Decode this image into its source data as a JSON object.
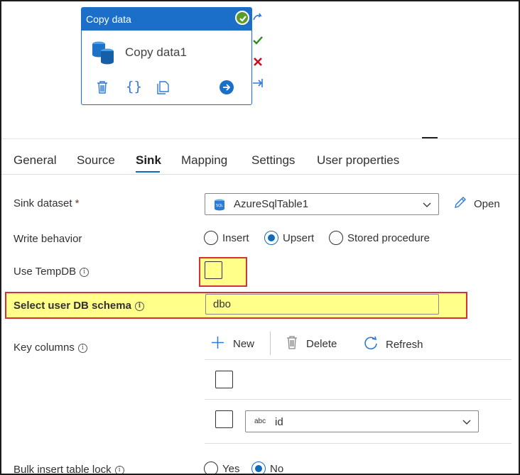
{
  "activity": {
    "type_label": "Copy data",
    "name": "Copy data1"
  },
  "tabs": [
    {
      "label": "General"
    },
    {
      "label": "Source"
    },
    {
      "label": "Sink"
    },
    {
      "label": "Mapping"
    },
    {
      "label": "Settings"
    },
    {
      "label": "User properties"
    }
  ],
  "active_tab": "Sink",
  "form": {
    "sink_dataset": {
      "label": "Sink dataset",
      "required_mark": "*",
      "value": "AzureSqlTable1",
      "open_label": "Open"
    },
    "write_behavior": {
      "label": "Write behavior",
      "options": [
        "Insert",
        "Upsert",
        "Stored procedure"
      ],
      "selected": "Upsert"
    },
    "use_tempdb": {
      "label": "Use TempDB",
      "checked": false
    },
    "user_db_schema": {
      "label": "Select user DB schema",
      "value": "dbo"
    },
    "key_columns": {
      "label": "Key columns",
      "toolbar": {
        "new_label": "New",
        "delete_label": "Delete",
        "refresh_label": "Refresh"
      },
      "rows": [
        {
          "type_badge": "abc",
          "value": "id"
        }
      ]
    },
    "bulk_insert_lock": {
      "label": "Bulk insert table lock",
      "options": [
        "Yes",
        "No"
      ],
      "selected": "No"
    }
  },
  "colors": {
    "accent": "#1c6fc9",
    "highlight": "#ffff8a",
    "highlight_border": "#d13438",
    "success": "#5a9c2a",
    "error": "#c50f1f"
  },
  "icons": {
    "status": "check-circle-icon",
    "activity": "database-icon",
    "delete": "trash-icon",
    "code": "braces-icon",
    "copy": "copy-icon",
    "go": "arrow-circle-icon",
    "dataset": "sql-table-icon",
    "edit": "pencil-icon"
  }
}
